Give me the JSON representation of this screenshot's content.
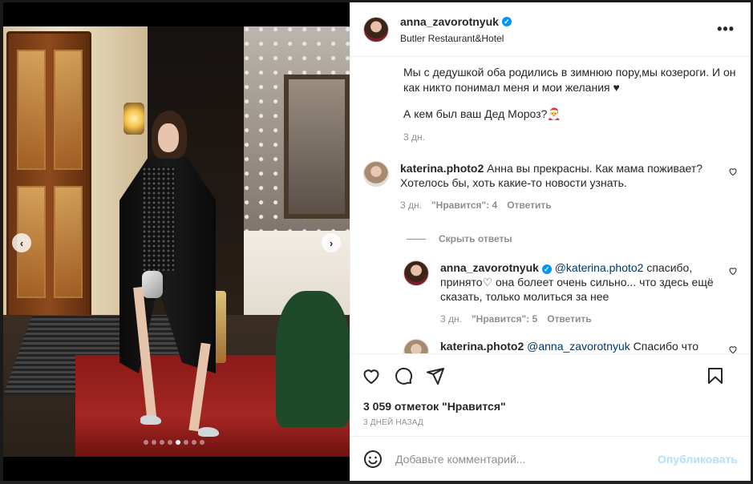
{
  "post": {
    "author": "anna_zavorotnyuk",
    "location": "Butler Restaurant&Hotel",
    "more_label": "•••",
    "caption_lines": [
      "Мы с дедушкой оба родились в зимнюю пору,мы козероги. И он как никто понимал меня и мои желания ♥",
      "А кем был ваш Дед Мороз?🎅"
    ],
    "caption_time": "3 дн."
  },
  "carousel": {
    "prev_icon": "chevron-left-icon",
    "next_icon": "chevron-right-icon",
    "prev_glyph": "‹",
    "next_glyph": "›",
    "slide_count": 8,
    "active_index": 4
  },
  "comments": [
    {
      "user": "katerina.photo2",
      "text": "Анна вы прекрасны. Как мама поживает? Хотелось бы, хоть какие-то новости узнать.",
      "time": "3 дн.",
      "likes": "\"Нравится\": 4",
      "reply_label": "Ответить"
    }
  ],
  "replies_toggle": "Скрыть ответы",
  "replies": [
    {
      "user": "anna_zavorotnyuk",
      "mention": "@katerina.photo2",
      "text": " спасибо, принято♡  она болеет очень сильно... что здесь ещё сказать, только молиться за нее",
      "time": "3 дн.",
      "likes": "\"Нравится\": 5",
      "reply_label": "Ответить"
    },
    {
      "user": "katerina.photo2",
      "mention": "@anna_zavorotnyuk",
      "text": " Спасибо что ответили. Я так надеялась, что ей лучше и что вы поше"
    }
  ],
  "footer": {
    "likes": "3 059 отметок \"Нравится\"",
    "date": "3 ДНЕЙ НАЗАД",
    "comment_placeholder": "Добавьте комментарий...",
    "publish_label": "Опубликовать"
  },
  "colors": {
    "link": "#00376b",
    "verified": "#0095f6",
    "publish_disabled": "#b2dffc",
    "muted": "#8e8e8e"
  }
}
